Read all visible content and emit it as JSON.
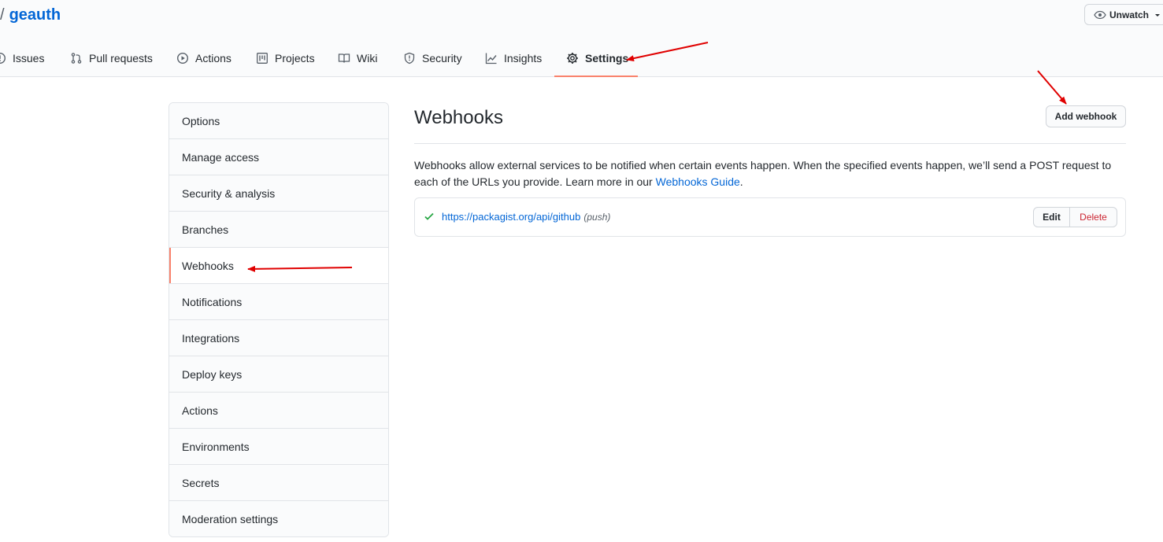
{
  "repo": {
    "separator": "/",
    "name": "geauth"
  },
  "watch": {
    "label": "Unwatch"
  },
  "tabs": [
    {
      "label": "Issues",
      "icon": "issue-icon"
    },
    {
      "label": "Pull requests",
      "icon": "pull-request-icon"
    },
    {
      "label": "Actions",
      "icon": "play-icon"
    },
    {
      "label": "Projects",
      "icon": "project-icon"
    },
    {
      "label": "Wiki",
      "icon": "book-icon"
    },
    {
      "label": "Security",
      "icon": "shield-icon"
    },
    {
      "label": "Insights",
      "icon": "graph-icon"
    },
    {
      "label": "Settings",
      "icon": "gear-icon",
      "selected": true
    }
  ],
  "sidebar": {
    "items": [
      {
        "label": "Options"
      },
      {
        "label": "Manage access"
      },
      {
        "label": "Security & analysis"
      },
      {
        "label": "Branches"
      },
      {
        "label": "Webhooks",
        "selected": true
      },
      {
        "label": "Notifications"
      },
      {
        "label": "Integrations"
      },
      {
        "label": "Deploy keys"
      },
      {
        "label": "Actions"
      },
      {
        "label": "Environments"
      },
      {
        "label": "Secrets"
      },
      {
        "label": "Moderation settings"
      }
    ]
  },
  "main": {
    "title": "Webhooks",
    "add_button": "Add webhook",
    "description": "Webhooks allow external services to be notified when certain events happen. When the specified events happen, we’ll send a POST request to each of the URLs you provide. Learn more in our",
    "guide_link": "Webhooks Guide",
    "period": "."
  },
  "webhook": {
    "url": "https://packagist.org/api/github",
    "events": "(push)",
    "edit_label": "Edit",
    "delete_label": "Delete",
    "status": "success"
  },
  "colors": {
    "link": "#0366d6",
    "accent": "#f9826c",
    "danger": "#cb2431",
    "success": "#28a745",
    "annotation": "#e00000"
  }
}
